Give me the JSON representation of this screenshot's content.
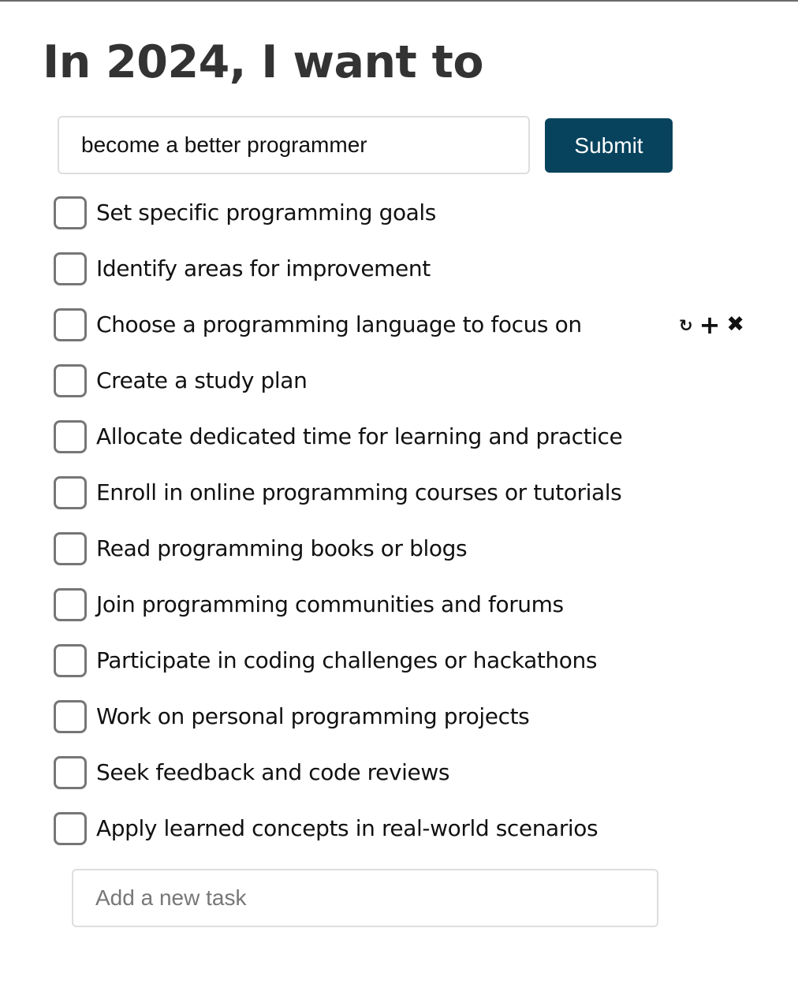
{
  "page": {
    "title": "In 2024, I want to"
  },
  "goal_form": {
    "input_value": "become a better programmer",
    "submit_label": "Submit"
  },
  "tasks": [
    {
      "label": "Set specific programming goals",
      "checked": false
    },
    {
      "label": "Identify areas for improvement",
      "checked": false
    },
    {
      "label": "Choose a programming language to focus on",
      "checked": false,
      "hovered": true
    },
    {
      "label": "Create a study plan",
      "checked": false
    },
    {
      "label": "Allocate dedicated time for learning and practice",
      "checked": false
    },
    {
      "label": "Enroll in online programming courses or tutorials",
      "checked": false
    },
    {
      "label": "Read programming books or blogs",
      "checked": false
    },
    {
      "label": "Join programming communities and forums",
      "checked": false
    },
    {
      "label": "Participate in coding challenges or hackathons",
      "checked": false
    },
    {
      "label": "Work on personal programming projects",
      "checked": false
    },
    {
      "label": "Seek feedback and code reviews",
      "checked": false
    },
    {
      "label": "Apply learned concepts in real-world scenarios",
      "checked": false
    }
  ],
  "task_actions": {
    "refresh_glyph": "↻",
    "add_glyph": "+",
    "delete_glyph": "✖",
    "icons": [
      "refresh-icon",
      "plus-icon",
      "close-icon"
    ]
  },
  "new_task": {
    "placeholder": "Add a new task",
    "value": ""
  },
  "colors": {
    "submit_bg": "#07435d",
    "title_text": "#333333",
    "checkbox_border": "#767676",
    "input_border": "#dedede"
  }
}
